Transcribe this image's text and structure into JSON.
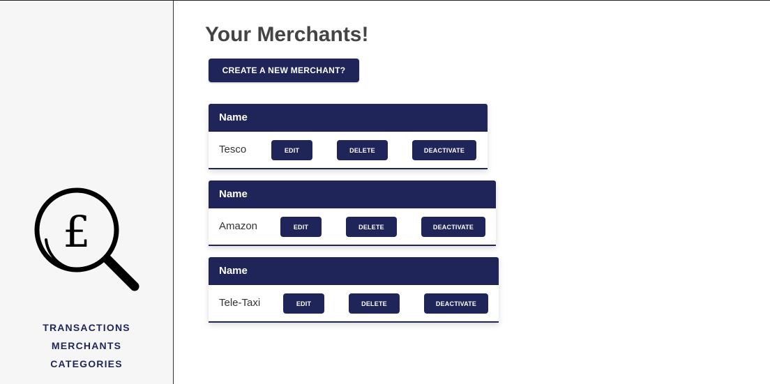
{
  "sidebar": {
    "logo_icon": "magnifier-pound-icon",
    "nav": [
      {
        "label": "TRANSACTIONS"
      },
      {
        "label": "MERCHANTS"
      },
      {
        "label": "CATEGORIES"
      }
    ]
  },
  "main": {
    "title": "Your Merchants!",
    "create_label": "CREATE A NEW MERCHANT?",
    "merchants": [
      {
        "header": "Name",
        "name": "Tesco",
        "edit": "EDIT",
        "delete": "DELETE",
        "deactivate": "DEACTIVATE"
      },
      {
        "header": "Name",
        "name": "Amazon",
        "edit": "EDIT",
        "delete": "DELETE",
        "deactivate": "DEACTIVATE"
      },
      {
        "header": "Name",
        "name": "Tele-Taxi",
        "edit": "EDIT",
        "delete": "DELETE",
        "deactivate": "DEACTIVATE"
      }
    ]
  },
  "colors": {
    "primary": "#1f2559",
    "sidebar_bg": "#f6f6f6",
    "title_text": "#444444"
  }
}
